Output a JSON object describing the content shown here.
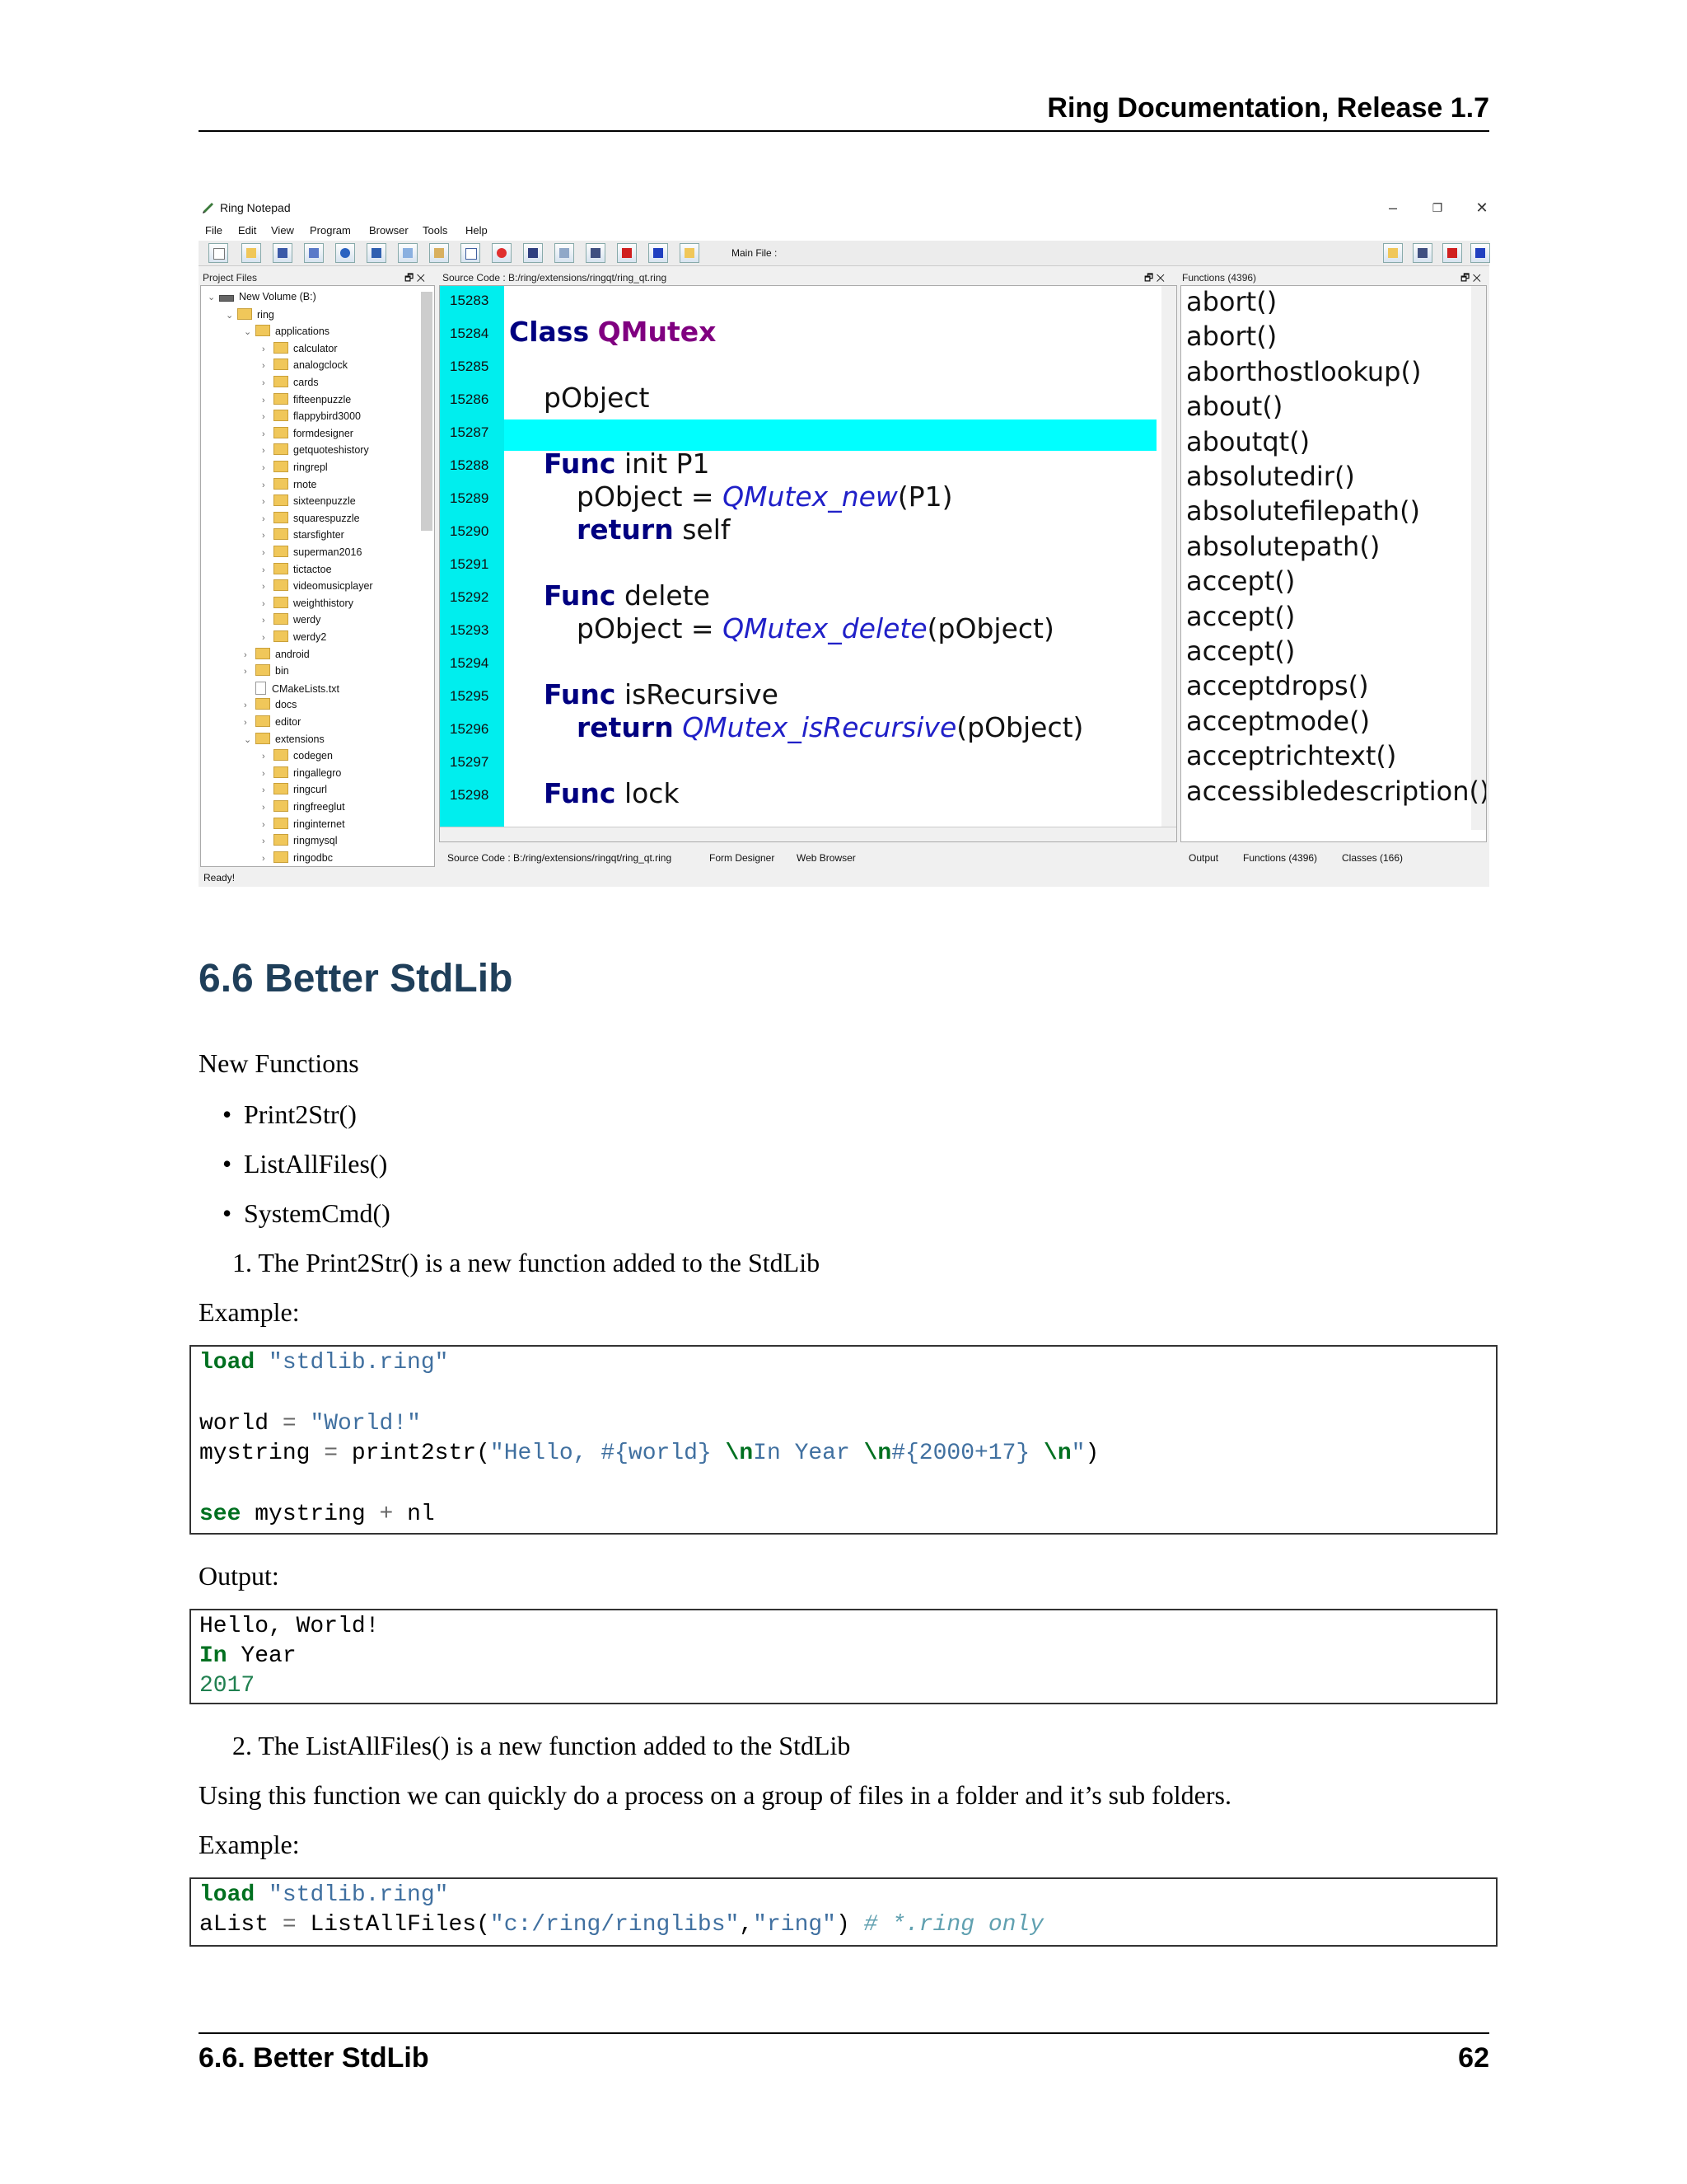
{
  "header": {
    "title": "Ring Documentation, Release 1.7"
  },
  "screenshot": {
    "window_title": "Ring Notepad",
    "menu": [
      "File",
      "Edit",
      "View",
      "Program",
      "Browser",
      "Tools",
      "Help"
    ],
    "main_file_label": "Main File :",
    "project_files": {
      "header": "Project Files",
      "tree": [
        {
          "label": "New Volume (B:)",
          "depth": 0,
          "icon": "drive-icon",
          "expanded": true
        },
        {
          "label": "ring",
          "depth": 1,
          "icon": "folder-icon",
          "expanded": true
        },
        {
          "label": "applications",
          "depth": 2,
          "icon": "folder-icon",
          "expanded": true
        },
        {
          "label": "calculator",
          "depth": 3,
          "icon": "folder-icon"
        },
        {
          "label": "analogclock",
          "depth": 3,
          "icon": "folder-icon"
        },
        {
          "label": "cards",
          "depth": 3,
          "icon": "folder-icon"
        },
        {
          "label": "fifteenpuzzle",
          "depth": 3,
          "icon": "folder-icon"
        },
        {
          "label": "flappybird3000",
          "depth": 3,
          "icon": "folder-icon"
        },
        {
          "label": "formdesigner",
          "depth": 3,
          "icon": "folder-icon"
        },
        {
          "label": "getquoteshistory",
          "depth": 3,
          "icon": "folder-icon"
        },
        {
          "label": "ringrepl",
          "depth": 3,
          "icon": "folder-icon"
        },
        {
          "label": "rnote",
          "depth": 3,
          "icon": "folder-icon"
        },
        {
          "label": "sixteenpuzzle",
          "depth": 3,
          "icon": "folder-icon"
        },
        {
          "label": "squarespuzzle",
          "depth": 3,
          "icon": "folder-icon"
        },
        {
          "label": "starsfighter",
          "depth": 3,
          "icon": "folder-icon"
        },
        {
          "label": "superman2016",
          "depth": 3,
          "icon": "folder-icon"
        },
        {
          "label": "tictactoe",
          "depth": 3,
          "icon": "folder-icon"
        },
        {
          "label": "videomusicplayer",
          "depth": 3,
          "icon": "folder-icon"
        },
        {
          "label": "weighthistory",
          "depth": 3,
          "icon": "folder-icon"
        },
        {
          "label": "werdy",
          "depth": 3,
          "icon": "folder-icon"
        },
        {
          "label": "werdy2",
          "depth": 3,
          "icon": "folder-icon"
        },
        {
          "label": "android",
          "depth": 2,
          "icon": "folder-icon"
        },
        {
          "label": "bin",
          "depth": 2,
          "icon": "folder-icon"
        },
        {
          "label": "CMakeLists.txt",
          "depth": 2,
          "icon": "file-icon",
          "leaf": true
        },
        {
          "label": "docs",
          "depth": 2,
          "icon": "folder-icon"
        },
        {
          "label": "editor",
          "depth": 2,
          "icon": "folder-icon"
        },
        {
          "label": "extensions",
          "depth": 2,
          "icon": "folder-icon",
          "expanded": true
        },
        {
          "label": "codegen",
          "depth": 3,
          "icon": "folder-icon"
        },
        {
          "label": "ringallegro",
          "depth": 3,
          "icon": "folder-icon"
        },
        {
          "label": "ringcurl",
          "depth": 3,
          "icon": "folder-icon"
        },
        {
          "label": "ringfreeglut",
          "depth": 3,
          "icon": "folder-icon"
        },
        {
          "label": "ringinternet",
          "depth": 3,
          "icon": "folder-icon"
        },
        {
          "label": "ringmysql",
          "depth": 3,
          "icon": "folder-icon"
        },
        {
          "label": "ringodbc",
          "depth": 3,
          "icon": "folder-icon"
        }
      ]
    },
    "source": {
      "header": "Source Code : B:/ring/extensions/ringqt/ring_qt.ring",
      "line_numbers": [
        "15283",
        "15284",
        "15285",
        "15286",
        "15287",
        "15288",
        "15289",
        "15290",
        "15291",
        "15292",
        "15293",
        "15294",
        "15295",
        "15296",
        "15297",
        "15298"
      ],
      "tabs": [
        "Source Code : B:/ring/extensions/ringqt/ring_qt.ring",
        "Form Designer",
        "Web Browser"
      ]
    },
    "functions": {
      "header": "Functions (4396)",
      "items": [
        "abort()",
        "abort()",
        "aborthostlookup()",
        "about()",
        "aboutqt()",
        "absolutedir()",
        "absolutefilepath()",
        "absolutepath()",
        "accept()",
        "accept()",
        "accept()",
        "acceptdrops()",
        "acceptmode()",
        "acceptrichtext()",
        "accessibledescription()"
      ],
      "tabs": [
        "Output",
        "Functions (4396)",
        "Classes (166)"
      ]
    },
    "status": "Ready!",
    "colors": {
      "gutter": "#00eeee",
      "highlight_line": "#00ffff",
      "keyword": "#000080",
      "classname": "#800080"
    }
  },
  "section": {
    "title": "6.6  Better StdLib",
    "intro": "New Functions",
    "bullets": [
      "Print2Str()",
      "ListAllFiles()",
      "SystemCmd()"
    ],
    "item1": "1.  The Print2Str() is a new function added to the StdLib",
    "example_label": "Example:",
    "output_label": "Output:",
    "item2": "2.  The ListAllFiles() is a new function added to the StdLib",
    "item2_desc": "Using this function we can quickly do a process on a group of files in a folder and it’s sub folders.",
    "example2_label": "Example:"
  },
  "footer": {
    "left": "6.6.  Better StdLib",
    "right": "62"
  }
}
